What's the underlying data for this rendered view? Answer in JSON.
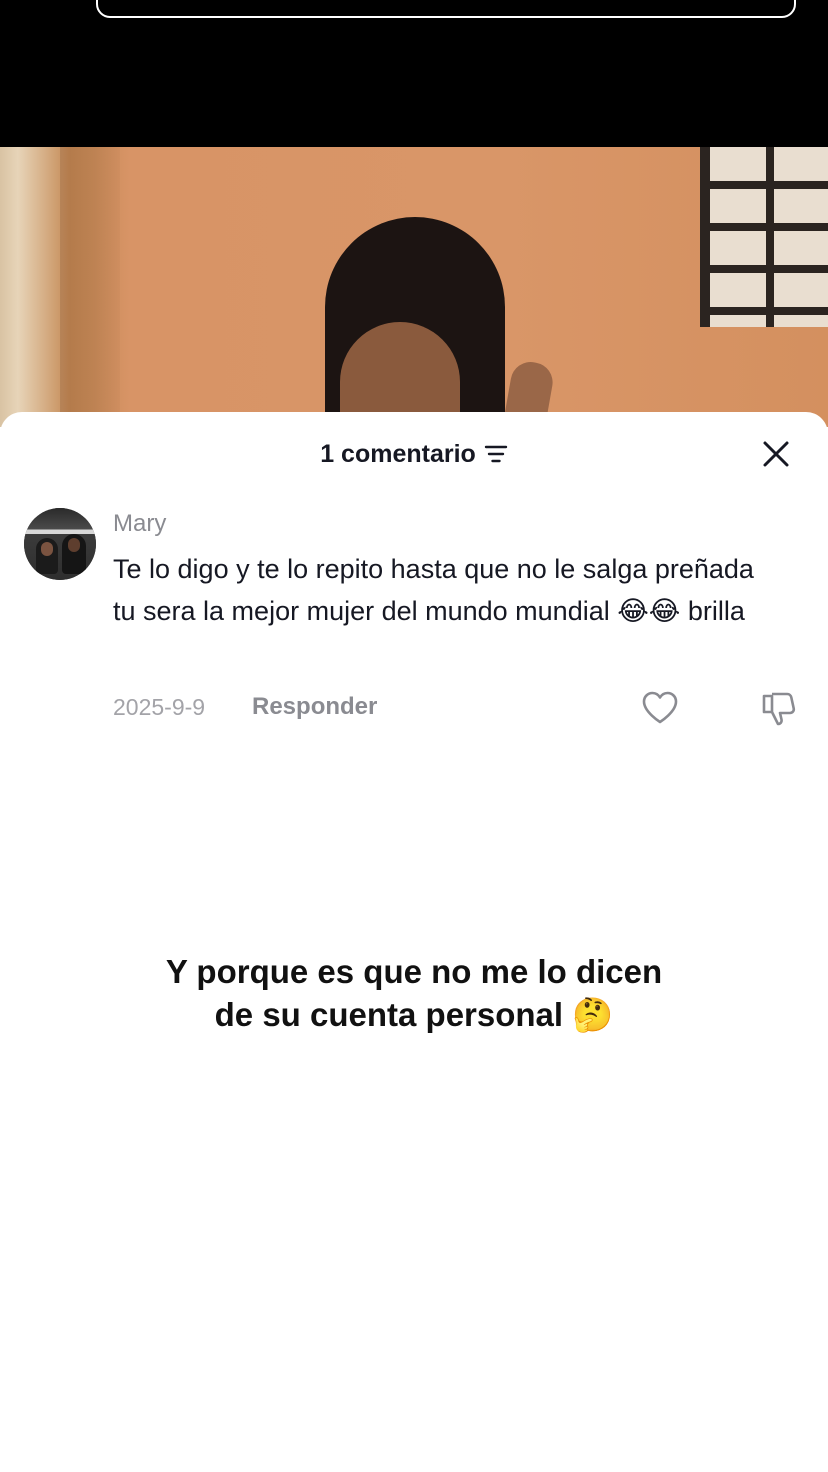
{
  "header": {
    "comment_count_label": "1 comentario"
  },
  "comment": {
    "username": "Mary",
    "text": "Te lo digo y te lo repito hasta que no le salga preñada tu sera la mejor mujer del mundo mundial 😂😂 brilla",
    "date": "2025-9-9",
    "reply_label": "Responder"
  },
  "overlay_caption": "Y porque es que no me lo dicen de su cuenta personal 🤔",
  "icons": {
    "filter": "filter-icon",
    "close": "close-icon",
    "like": "heart-icon",
    "dislike": "thumbs-down-icon"
  },
  "colors": {
    "text_primary": "#161823",
    "text_secondary": "#8a8b91",
    "background": "#ffffff",
    "top_bar": "#000000"
  }
}
